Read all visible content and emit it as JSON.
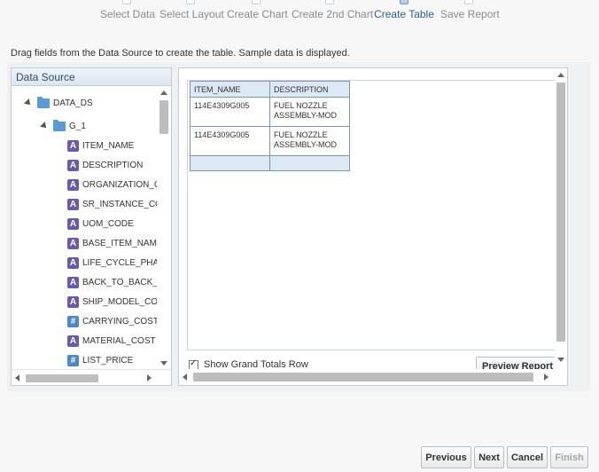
{
  "wizard": {
    "steps": [
      {
        "label": "Select Data",
        "active": false
      },
      {
        "label": "Select Layout",
        "active": false
      },
      {
        "label": "Create Chart",
        "active": false
      },
      {
        "label": "Create 2nd Chart",
        "active": false
      },
      {
        "label": "Create Table",
        "active": true
      },
      {
        "label": "Save Report",
        "active": false
      }
    ]
  },
  "instructions": "Drag fields from the Data Source to create the table. Sample data is displayed.",
  "data_source": {
    "title": "Data Source",
    "root": "DATA_DS",
    "group": "G_1",
    "fields": [
      {
        "label": "ITEM_NAME",
        "type": "A"
      },
      {
        "label": "DESCRIPTION",
        "type": "A"
      },
      {
        "label": "ORGANIZATION_C",
        "type": "A"
      },
      {
        "label": "SR_INSTANCE_CC",
        "type": "A"
      },
      {
        "label": "UOM_CODE",
        "type": "A"
      },
      {
        "label": "BASE_ITEM_NAMI",
        "type": "A"
      },
      {
        "label": "LIFE_CYCLE_PHA",
        "type": "A"
      },
      {
        "label": "BACK_TO_BACK_",
        "type": "A"
      },
      {
        "label": "SHIP_MODEL_CO",
        "type": "A"
      },
      {
        "label": "CARRYING_COST",
        "type": "#"
      },
      {
        "label": "MATERIAL_COST",
        "type": "A"
      },
      {
        "label": "LIST_PRICE",
        "type": "#"
      }
    ]
  },
  "table": {
    "headers": [
      "ITEM_NAME",
      "DESCRIPTION"
    ],
    "rows": [
      [
        "114E4309G005",
        "FUEL NOZZLE ASSEMBLY-MOD"
      ],
      [
        "114E4309G005",
        "FUEL NOZZLE ASSEMBLY-MOD"
      ]
    ]
  },
  "options": {
    "grand_totals_label": "Show Grand Totals Row",
    "grand_totals_checked": true,
    "preview_label": "Preview Report"
  },
  "footer": {
    "previous": "Previous",
    "next": "Next",
    "cancel": "Cancel",
    "finish": "Finish"
  }
}
